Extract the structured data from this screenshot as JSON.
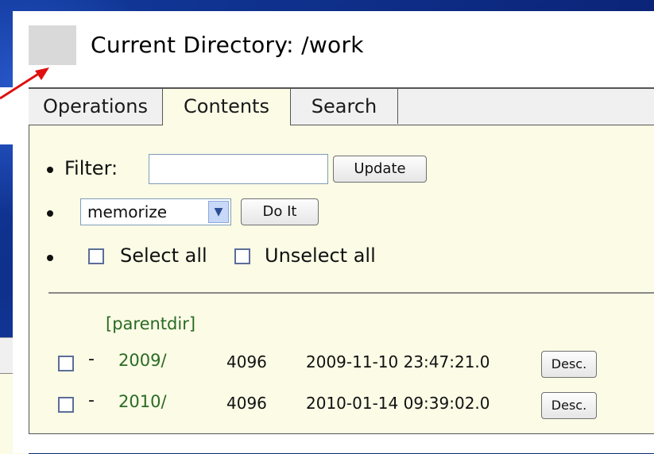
{
  "header": {
    "title": "Current Directory: /work"
  },
  "tabs": [
    {
      "label": "Operations",
      "active": false
    },
    {
      "label": "Contents",
      "active": true
    },
    {
      "label": "Search",
      "active": false
    }
  ],
  "filter": {
    "label": "Filter:",
    "value": "",
    "placeholder": "",
    "button_label": "Update"
  },
  "action": {
    "selected": "memorize",
    "button_label": "Do It"
  },
  "selection": {
    "select_all_label": "Select all",
    "unselect_all_label": "Unselect all"
  },
  "listing": {
    "parent_link": "[parentdir]",
    "rows": [
      {
        "dash": "-",
        "name": "2009/",
        "size": "4096",
        "modified": "2009-11-10 23:47:21.0",
        "desc_label": "Desc."
      },
      {
        "dash": "-",
        "name": "2010/",
        "size": "4096",
        "modified": "2010-01-14 09:39:02.0",
        "desc_label": "Desc."
      }
    ]
  },
  "colors": {
    "slide_background": "#0e2a7a",
    "panel_background": "#fbfbe6",
    "link_green": "#2a6b23",
    "arrow_red": "#e01010"
  }
}
